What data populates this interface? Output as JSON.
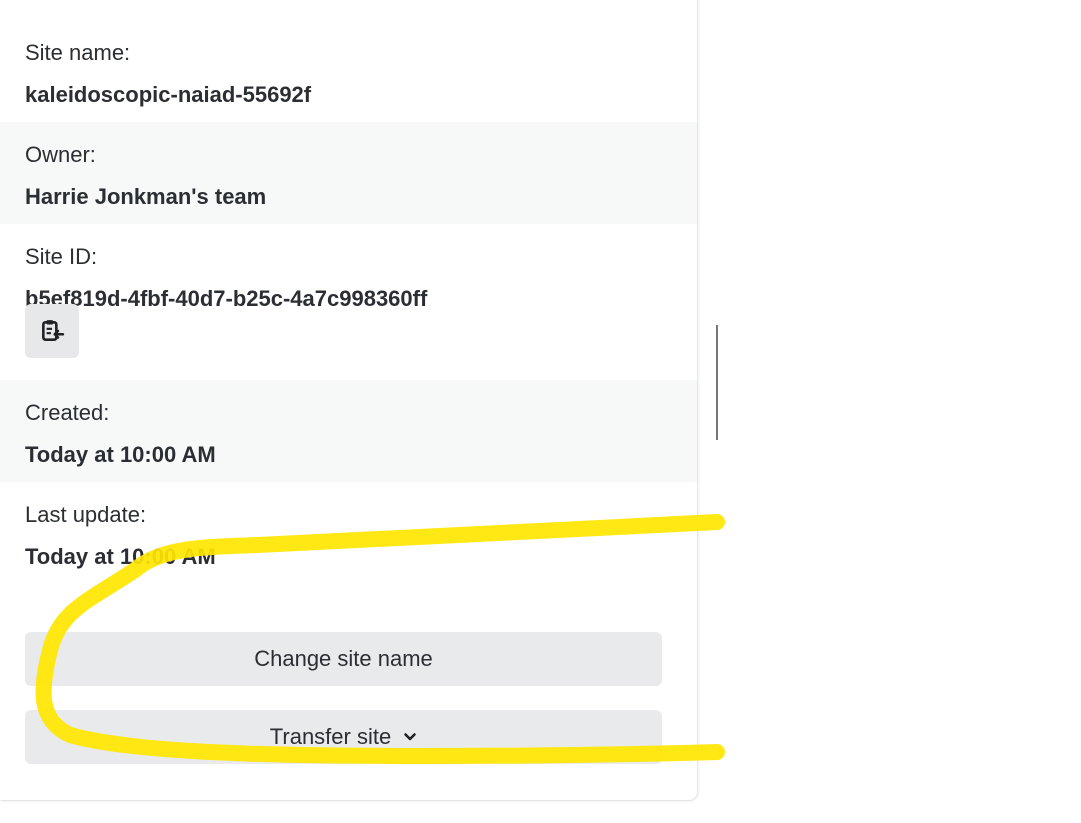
{
  "site_info": {
    "site_name_label": "Site name:",
    "site_name_value": "kaleidoscopic-naiad-55692f",
    "owner_label": "Owner:",
    "owner_value": "Harrie Jonkman's team",
    "site_id_label": "Site ID:",
    "site_id_value": "b5ef819d-4fbf-40d7-b25c-4a7c998360ff",
    "created_label": "Created:",
    "created_value": "Today at 10:00 AM",
    "last_update_label": "Last update:",
    "last_update_value": "Today at 10:00 AM"
  },
  "actions": {
    "change_site_name_label": "Change site name",
    "transfer_site_label": "Transfer site"
  },
  "icons": {
    "copy": "clipboard-copy-icon",
    "transfer_chevron": "chevron-down-icon"
  },
  "colors": {
    "highlight": "#ffe600",
    "button_bg": "#e9eaec",
    "alt_row_bg": "#f7f9f9"
  }
}
